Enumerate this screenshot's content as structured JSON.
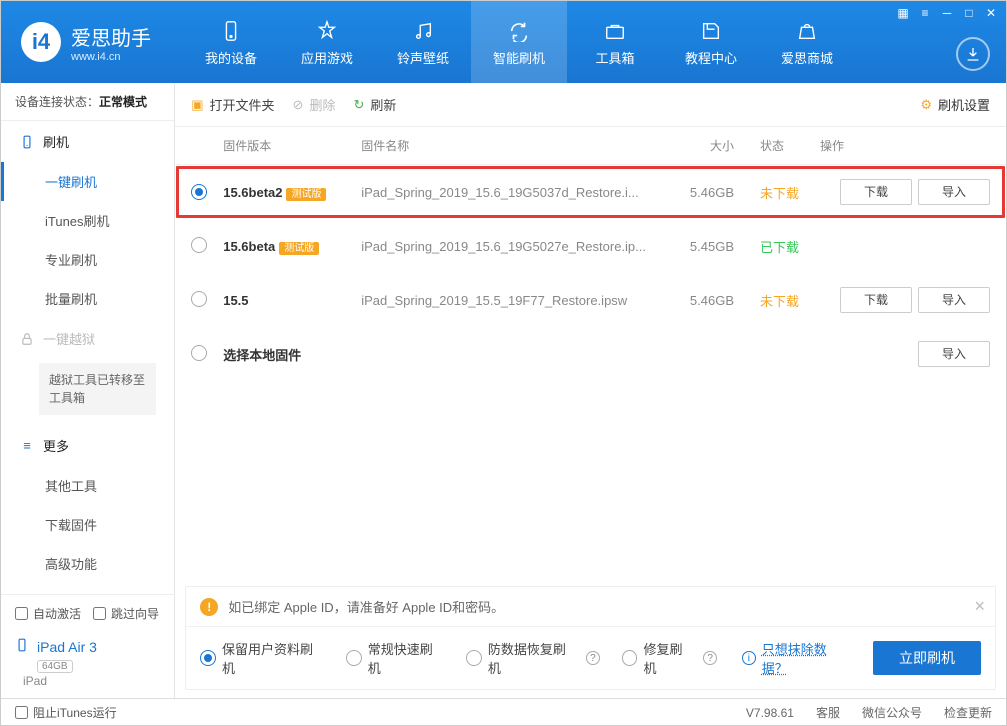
{
  "app": {
    "name": "爱思助手",
    "url": "www.i4.cn"
  },
  "nav": [
    "我的设备",
    "应用游戏",
    "铃声壁纸",
    "智能刷机",
    "工具箱",
    "教程中心",
    "爱思商城"
  ],
  "nav_active": 3,
  "sidebar": {
    "status_label": "设备连接状态：",
    "status_value": "正常模式",
    "g_flash": "刷机",
    "items_flash": [
      "一键刷机",
      "iTunes刷机",
      "专业刷机",
      "批量刷机"
    ],
    "g_jail": "一键越狱",
    "jail_notice": "越狱工具已转移至工具箱",
    "g_more": "更多",
    "items_more": [
      "其他工具",
      "下载固件",
      "高级功能"
    ],
    "chk_auto": "自动激活",
    "chk_skip": "跳过向导",
    "device_name": "iPad Air 3",
    "device_cap": "64GB",
    "device_type": "iPad"
  },
  "toolbar": {
    "open": "打开文件夹",
    "delete": "删除",
    "refresh": "刷新",
    "settings": "刷机设置"
  },
  "columns": {
    "ver": "固件版本",
    "name": "固件名称",
    "size": "大小",
    "status": "状态",
    "ops": "操作"
  },
  "rows": [
    {
      "selected": true,
      "ver": "15.6beta2",
      "beta": "测试版",
      "name": "iPad_Spring_2019_15.6_19G5037d_Restore.i...",
      "size": "5.46GB",
      "status": "未下载",
      "status_cls": "st-orange",
      "dl": true,
      "imp": true,
      "hl": true
    },
    {
      "selected": false,
      "ver": "15.6beta",
      "beta": "测试版",
      "name": "iPad_Spring_2019_15.6_19G5027e_Restore.ip...",
      "size": "5.45GB",
      "status": "已下载",
      "status_cls": "st-green",
      "dl": false,
      "imp": false,
      "hl": false
    },
    {
      "selected": false,
      "ver": "15.5",
      "beta": "",
      "name": "iPad_Spring_2019_15.5_19F77_Restore.ipsw",
      "size": "5.46GB",
      "status": "未下载",
      "status_cls": "st-orange",
      "dl": true,
      "imp": true,
      "hl": false
    },
    {
      "selected": false,
      "ver": "选择本地固件",
      "beta": "",
      "name": "",
      "size": "",
      "status": "",
      "status_cls": "",
      "dl": false,
      "imp": true,
      "hl": false
    }
  ],
  "btn": {
    "download": "下载",
    "import": "导入"
  },
  "info": {
    "warn": "如已绑定 Apple ID，请准备好 Apple ID和密码。",
    "opt1": "保留用户资料刷机",
    "opt2": "常规快速刷机",
    "opt3": "防数据恢复刷机",
    "opt4": "修复刷机",
    "erase_link": "只想抹除数据？",
    "go": "立即刷机"
  },
  "status": {
    "block": "阻止iTunes运行",
    "ver": "V7.98.61",
    "kf": "客服",
    "wx": "微信公众号",
    "upd": "检查更新"
  }
}
